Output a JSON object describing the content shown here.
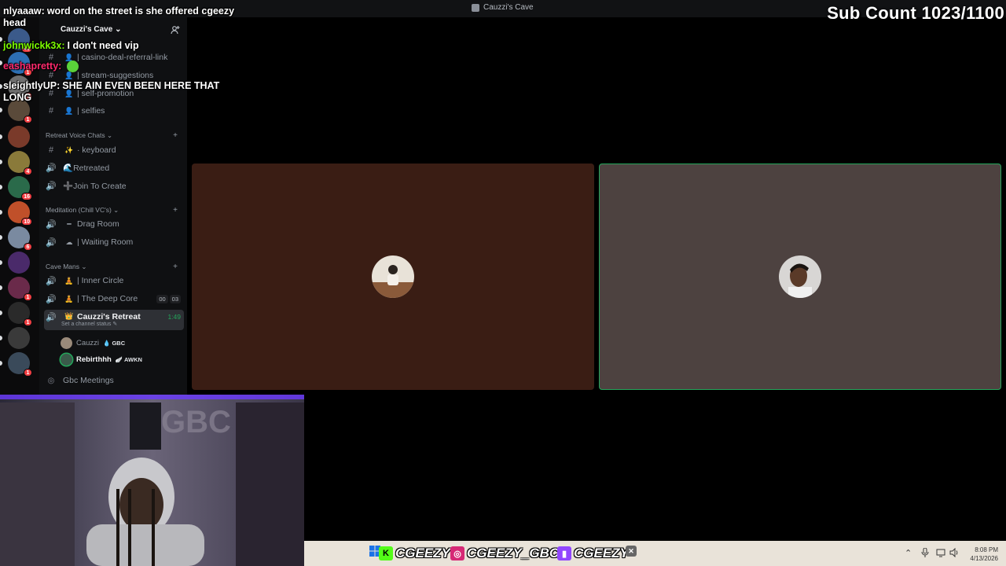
{
  "window": {
    "title": "Cauzzi's Cave"
  },
  "overlay": {
    "sub_count": "Sub Count 1023/1100",
    "chat": [
      {
        "user": "nlyaaaw:",
        "message": "word on the street is she offered cgeezy head",
        "color": "#ffffff"
      },
      {
        "user": "johnwickk3x:",
        "message": "I don't need vip",
        "color": "#7cfc00"
      },
      {
        "user": "eashapretty:",
        "message": "",
        "color": "#ff2a6d"
      },
      {
        "user": "sleightlyUP:",
        "message": "SHE AIN EVEN BEEN HERE THAT LONG",
        "color": "#ffffff"
      }
    ],
    "socials": [
      {
        "icon": "kick-icon",
        "color": "#53fc18",
        "handle": "CGEEZY"
      },
      {
        "icon": "instagram-icon",
        "color": "#d62976",
        "handle": "CGEEZY_GBC"
      },
      {
        "icon": "twitch-icon",
        "color": "#9146ff",
        "handle": "CGEEZY"
      }
    ]
  },
  "server": {
    "name": "Cauzzi's Cave ⌄"
  },
  "servers": [
    {
      "badge": "40",
      "color": "#3b5a8a"
    },
    {
      "badge": "1",
      "color": "#2d6fb3"
    },
    {
      "badge": "6",
      "color": "#6f6f6f"
    },
    {
      "badge": "1",
      "color": "#5a4a3a"
    },
    {
      "badge": "",
      "color": "#7a3a2a"
    },
    {
      "badge": "4",
      "color": "#8a7a3a"
    },
    {
      "badge": "16",
      "color": "#2a6a4a"
    },
    {
      "badge": "10",
      "color": "#c0502a"
    },
    {
      "badge": "6",
      "color": "#7a8aa0"
    },
    {
      "badge": "",
      "color": "#4a2a6a"
    },
    {
      "badge": "1",
      "color": "#6a2a4a"
    },
    {
      "badge": "1",
      "color": "#2a2a2a"
    },
    {
      "badge": "",
      "color": "#3a3a3a"
    },
    {
      "badge": "1",
      "color": "#3a4a5a"
    },
    {
      "badge": "4",
      "color": "#3a7a3a"
    },
    {
      "badge": "",
      "color": "#8a3a5a"
    }
  ],
  "channels_top": [
    {
      "prefix": "#",
      "emoji": "👤",
      "label": "| casino-deal-referral-link"
    },
    {
      "prefix": "#",
      "emoji": "👤",
      "label": "| stream-suggestions"
    },
    {
      "prefix": "#",
      "emoji": "👤",
      "label": "| self-promotion"
    },
    {
      "prefix": "#",
      "emoji": "👤",
      "label": "| selfies"
    }
  ],
  "categories": {
    "retreat": "Retreat Voice Chats ⌄",
    "meditation": "Meditation (Chill VC's) ⌄",
    "cave": "Cave Mans ⌄"
  },
  "retreat_channels": [
    {
      "prefix": "#",
      "emoji": "✨",
      "label": "· keyboard"
    },
    {
      "prefix": "🔊",
      "emoji": "",
      "label": "🌊Retreated"
    },
    {
      "prefix": "🔊",
      "emoji": "",
      "label": "➕Join To Create"
    }
  ],
  "meditation_channels": [
    {
      "prefix": "🔊",
      "emoji": "━",
      "label": "Drag Room"
    },
    {
      "prefix": "🔊",
      "emoji": "☁",
      "label": "| Waiting Room"
    }
  ],
  "cave_channels": [
    {
      "prefix": "🔊",
      "emoji": "🧘",
      "label": "| Inner Circle"
    },
    {
      "prefix": "🔊",
      "emoji": "🧘",
      "label": "| The Deep Core",
      "counts": [
        "00",
        "03"
      ]
    }
  ],
  "active_channel": {
    "prefix": "🔊",
    "emoji": "👑",
    "label": "Cauzzi's Retreat",
    "timer": "1:49",
    "status": "Set a channel status ✎"
  },
  "voice_users": [
    {
      "name": "Cauzzi",
      "tag": "💧 GBC",
      "tag_color": "#e0e3e7"
    },
    {
      "name": "Rebirthhh",
      "tag": "🪽 AWKN",
      "tag_color": "#e0e3e7"
    }
  ],
  "bottom_channel": {
    "label": "Gbc Meetings"
  },
  "clock": {
    "time": "8:08 PM",
    "date": "4/13/2026"
  },
  "colors": {
    "speaking": "#23a55a",
    "tile_left": "#3a1d14",
    "tile_right": "#4d4240"
  }
}
